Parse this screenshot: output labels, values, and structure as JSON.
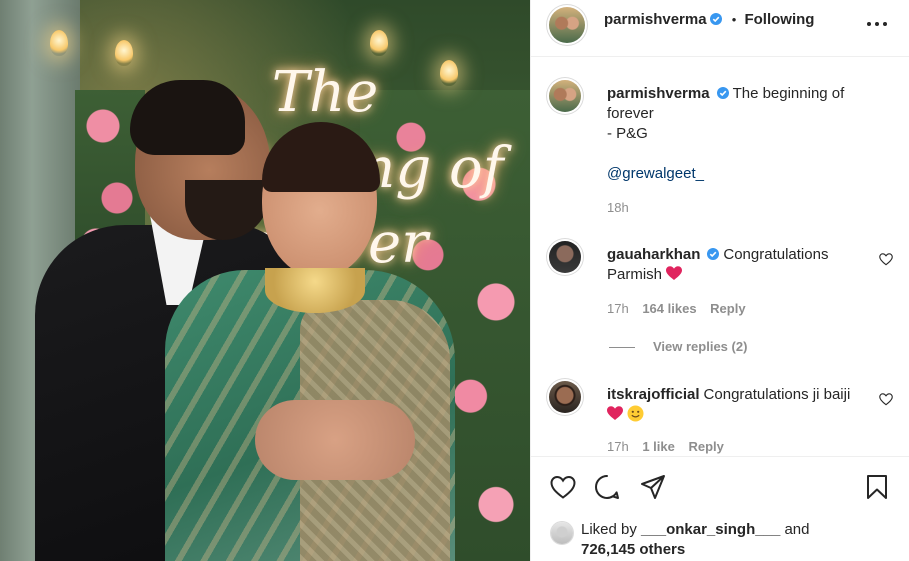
{
  "header": {
    "username": "parmishverma",
    "separator": "•",
    "follow_status": "Following"
  },
  "caption": {
    "username": "parmishverma",
    "text": "The beginning of forever",
    "signature": "- P&G",
    "mention": "@grewalgeet_",
    "time": "18h"
  },
  "comments": [
    {
      "username": "gauaharkhan",
      "text": "Congratulations Parmish",
      "time": "17h",
      "likes": "164 likes",
      "reply": "Reply",
      "view_replies": "View replies (2)"
    },
    {
      "username": "itskrajofficial",
      "text": "Congratulations ji baiji",
      "time": "17h",
      "likes": "1 like",
      "reply": "Reply"
    }
  ],
  "likes": {
    "prefix": "Liked by",
    "user": "___onkar_singh___",
    "and": "and",
    "count": "726,145 others"
  },
  "image": {
    "neon_text": "The beginning of forever"
  },
  "icons": {
    "verified_color": "#3897f0",
    "heart_red": "#ed4956"
  }
}
